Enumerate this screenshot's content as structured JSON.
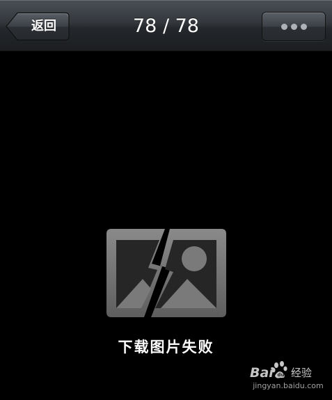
{
  "navbar": {
    "back_label": "返回",
    "page_counter": "78 / 78",
    "more_icon": "more-dots-icon"
  },
  "content": {
    "placeholder_icon": "broken-image-icon",
    "error_message": "下载图片失败"
  },
  "watermark": {
    "brand": "Bai",
    "suffix": "经验",
    "url": "jingyan.baidu.com"
  },
  "colors": {
    "background": "#000000",
    "navbar_top": "#4a4f55",
    "navbar_bottom": "#1c1e21",
    "icon_gray": "#7c7c7c"
  }
}
